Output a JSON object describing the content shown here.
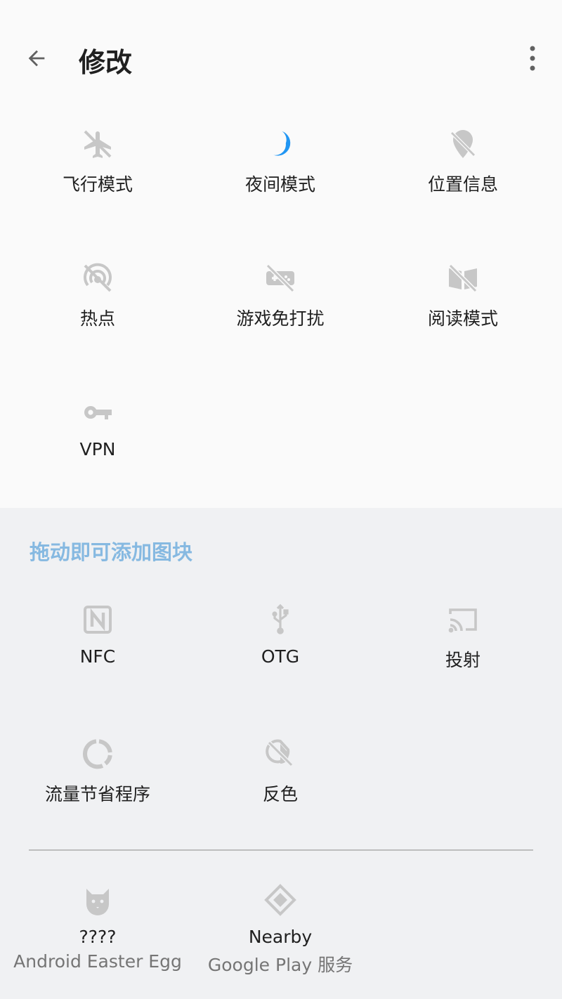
{
  "appbar": {
    "title": "修改"
  },
  "active_tiles": [
    {
      "label": "飞行模式"
    },
    {
      "label": "夜间模式"
    },
    {
      "label": "位置信息"
    },
    {
      "label": "热点"
    },
    {
      "label": "游戏免打扰"
    },
    {
      "label": "阅读模式"
    },
    {
      "label": "VPN"
    }
  ],
  "available_section": {
    "title": "拖动即可添加图块"
  },
  "available_tiles": [
    {
      "label": "NFC"
    },
    {
      "label": "OTG"
    },
    {
      "label": "投射"
    },
    {
      "label": "流量节省程序"
    },
    {
      "label": "反色"
    }
  ],
  "third_party_tiles": [
    {
      "label": "????",
      "sub": "Android Easter Egg"
    },
    {
      "label": "Nearby",
      "sub": "Google Play 服务"
    }
  ],
  "colors": {
    "accent_blue": "#2196f3",
    "section_title": "#86b9e1",
    "icon_gray": "#bdbdbd"
  }
}
